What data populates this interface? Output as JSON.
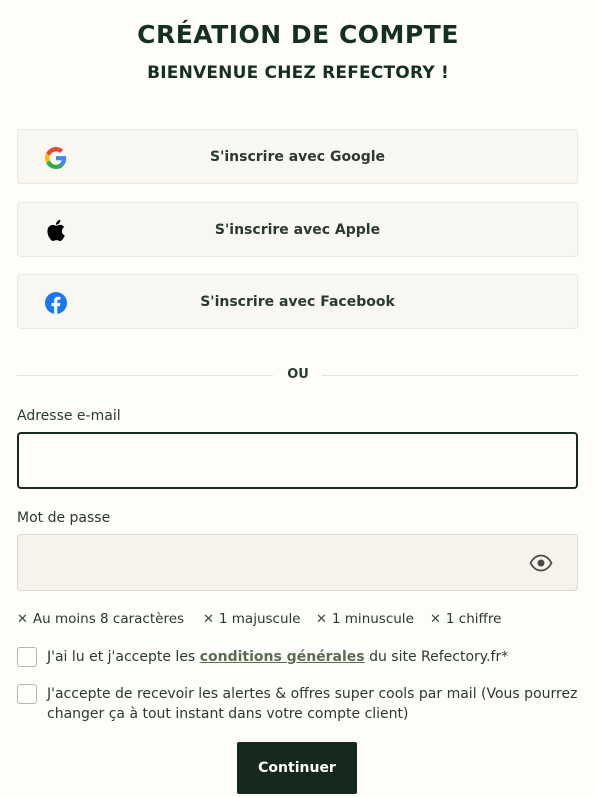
{
  "header": {
    "title": "CRÉATION DE COMPTE",
    "subtitle": "BIENVENUE CHEZ REFECTORY !"
  },
  "social": [
    {
      "label": "S'inscrire avec Google",
      "icon": "google-icon"
    },
    {
      "label": "S'inscrire avec Apple",
      "icon": "apple-icon"
    },
    {
      "label": "S'inscrire avec Facebook",
      "icon": "facebook-icon"
    }
  ],
  "divider": {
    "label": "OU"
  },
  "email": {
    "label": "Adresse e-mail",
    "value": "",
    "placeholder": ""
  },
  "password": {
    "label": "Mot de passe",
    "value": "",
    "placeholder": "",
    "toggle_icon": "eye-icon"
  },
  "password_rules": [
    {
      "label": "Au moins 8 caractères",
      "icon": "cross-icon"
    },
    {
      "label": "1 majuscule",
      "icon": "cross-icon"
    },
    {
      "label": "1 minuscule",
      "icon": "cross-icon"
    },
    {
      "label": "1 chiffre",
      "icon": "cross-icon"
    }
  ],
  "terms": {
    "prefix": "J'ai lu et j'accepte les ",
    "link": "conditions générales",
    "suffix": " du site Refectory.fr*",
    "checked": false
  },
  "newsletter": {
    "label": "J'accepte de recevoir les alertes & offres super cools par mail (Vous pourrez changer ça à tout instant dans votre compte client)",
    "checked": false
  },
  "submit": {
    "label": "Continuer"
  },
  "colors": {
    "primary": "#16291d",
    "background": "#fdfdfa",
    "social_bg": "#f9f7f1",
    "google_blue": "#4285F4",
    "google_red": "#EA4335",
    "google_yellow": "#FBBC05",
    "google_green": "#34A853",
    "facebook_blue": "#1877F2"
  }
}
